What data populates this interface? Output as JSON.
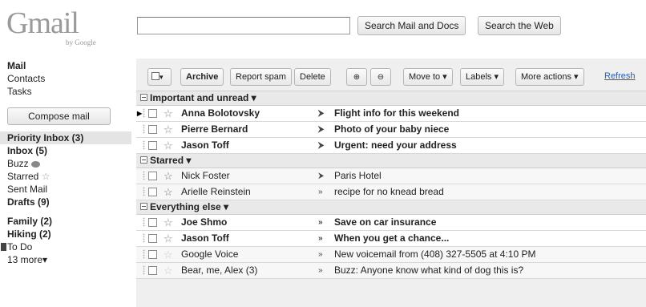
{
  "logo": {
    "word": "Gmail",
    "by": "by Google"
  },
  "search": {
    "value": "",
    "mail_button": "Search Mail and Docs",
    "web_button": "Search the Web"
  },
  "sidebar": {
    "top": [
      "Mail",
      "Contacts",
      "Tasks"
    ],
    "compose": "Compose mail",
    "labels": [
      "Priority Inbox (3)",
      "Inbox (5)",
      "Buzz",
      "Starred",
      "Sent Mail",
      "Drafts (9)"
    ],
    "custom": [
      "Family (2)",
      "Hiking (2)",
      "To Do",
      "13 more▾"
    ]
  },
  "toolbar": {
    "select": "▾",
    "archive": "Archive",
    "spam": "Report spam",
    "delete": "Delete",
    "move": "Move to ▾",
    "labels": "Labels ▾",
    "more": "More actions ▾",
    "refresh": "Refresh"
  },
  "sections": {
    "important": "Important and unread ▾",
    "starred": "Starred ▾",
    "everything": "Everything else ▾"
  },
  "rows": [
    {
      "sender": "Anna Bolotovsky",
      "subject": "Flight info for this weekend",
      "marker": "⮞"
    },
    {
      "sender": "Pierre Bernard",
      "subject": "Photo of your baby niece",
      "marker": "⮞"
    },
    {
      "sender": "Jason Toff",
      "subject": "Urgent: need your address",
      "marker": "⮞"
    },
    {
      "sender": "Nick Foster",
      "subject": "Paris Hotel",
      "marker": "⮞"
    },
    {
      "sender": "Arielle Reinstein",
      "subject": "recipe for no knead bread",
      "marker": "»"
    },
    {
      "sender": "Joe Shmo",
      "subject": "Save on car insurance",
      "marker": "»"
    },
    {
      "sender": "Jason Toff",
      "subject": "When you get a chance...",
      "marker": "»"
    },
    {
      "sender": "Google Voice",
      "subject": "New voicemail from (408) 327-5505 at 4:10 PM",
      "marker": "»"
    },
    {
      "sender": "Bear, me, Alex (3)",
      "subject": "Buzz: Anyone know what kind of dog this is?",
      "marker": "»"
    }
  ],
  "colors": {
    "panel": "#efefef",
    "selected": "#e4e4e4",
    "todo": "#444444",
    "link": "#2a5db0"
  }
}
